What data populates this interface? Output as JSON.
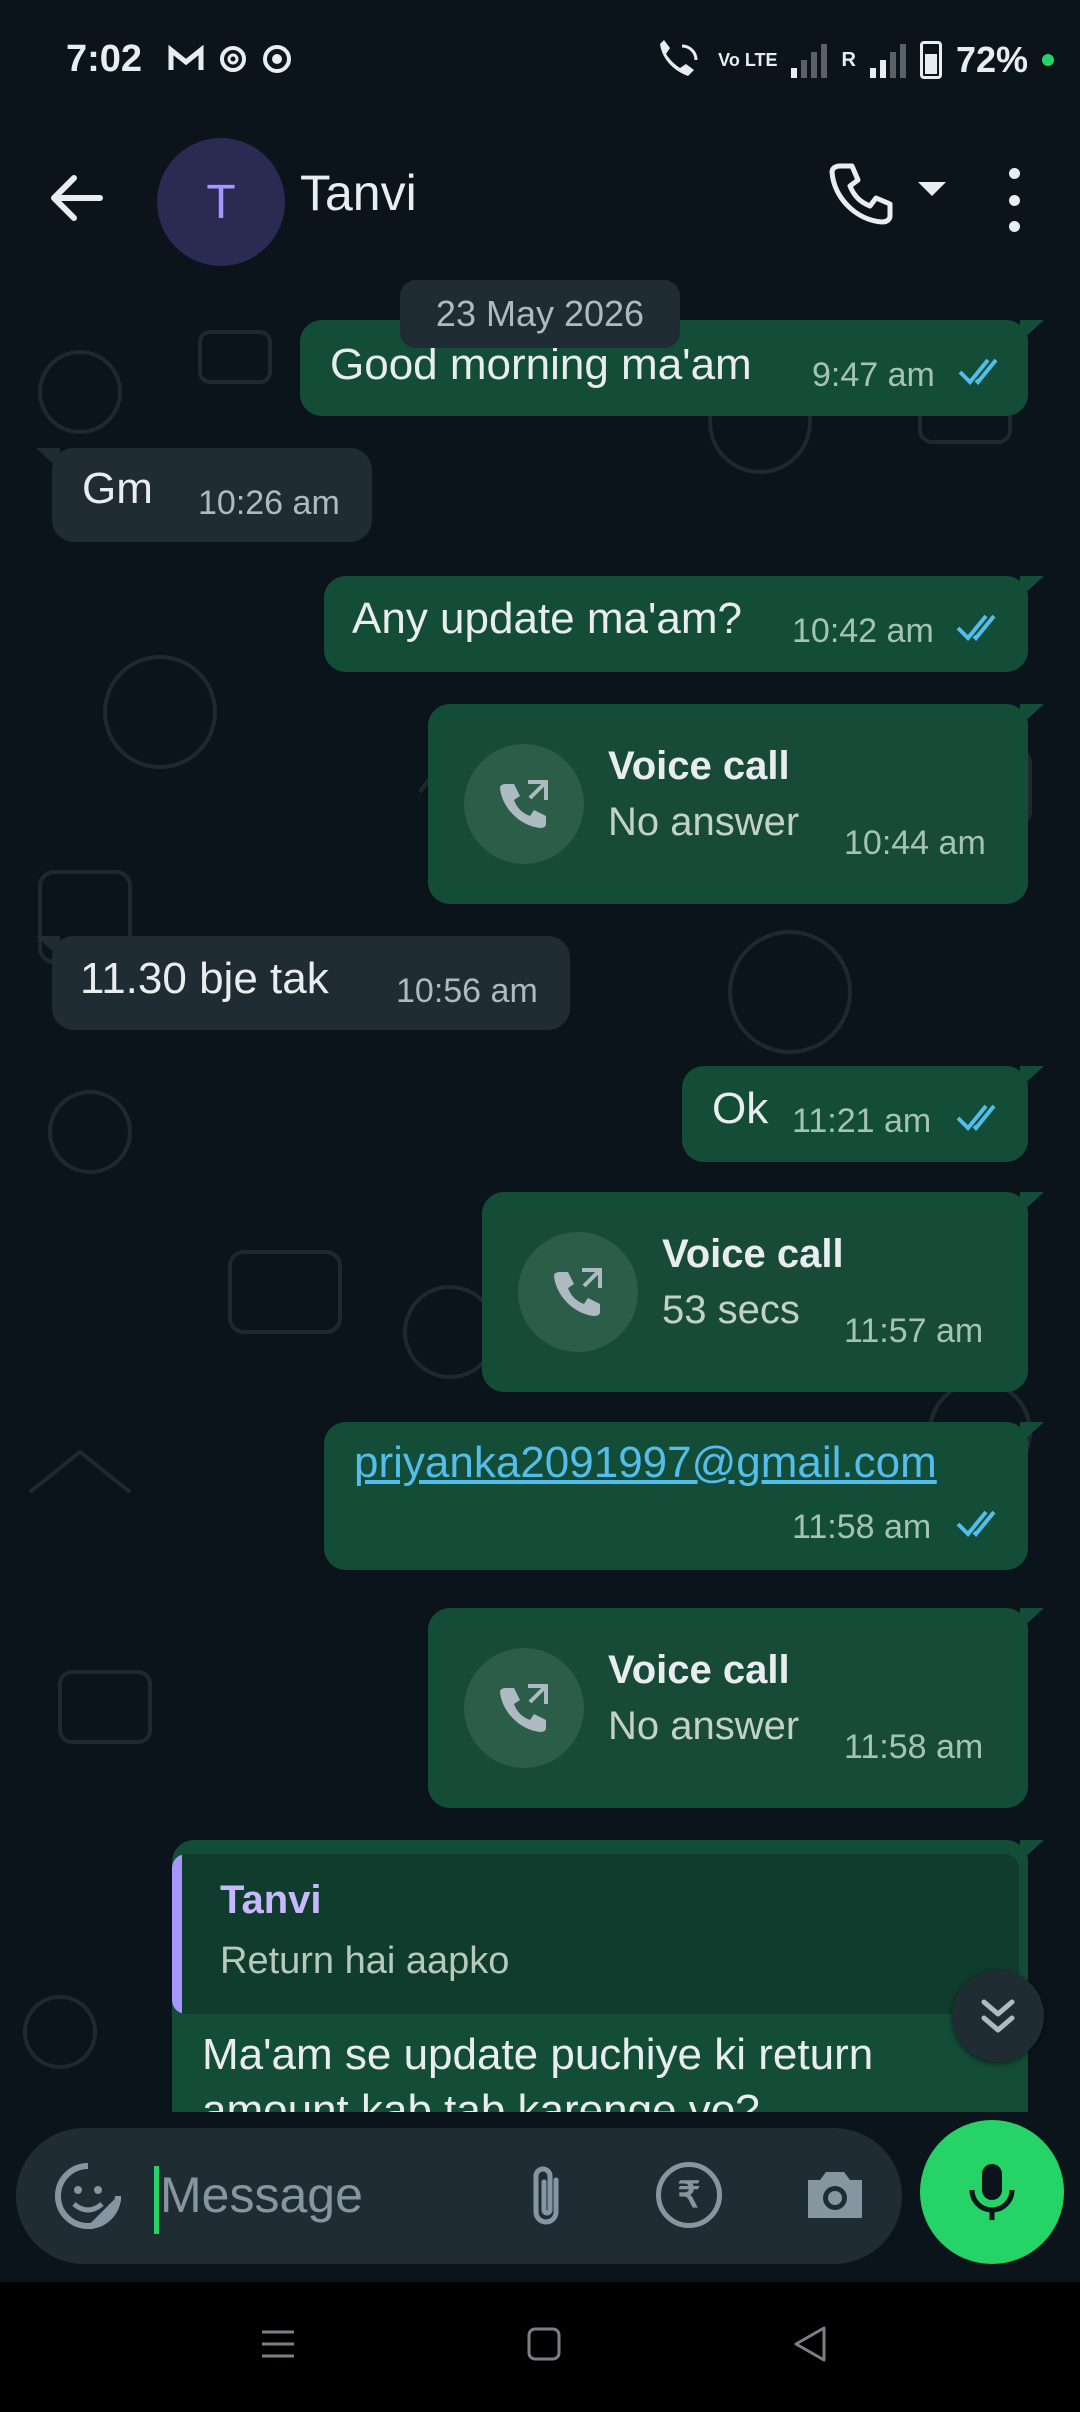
{
  "status_bar": {
    "time": "7:02",
    "network_label": "Vo LTE",
    "roaming": "R",
    "battery": "72%"
  },
  "header": {
    "avatar_initial": "T",
    "contact_name": "Tanvi"
  },
  "chat": {
    "date_chip": "23 May 2026",
    "messages": [
      {
        "text": "Good morning ma'am",
        "time": "9:47 am"
      },
      {
        "text": "Gm",
        "time": "10:26 am"
      },
      {
        "text": "Any update ma'am?",
        "time": "10:42 am"
      },
      {
        "title": "Voice call",
        "subtitle": "No answer",
        "time": "10:44 am"
      },
      {
        "text": "11.30 bje tak",
        "time": "10:56 am"
      },
      {
        "text": "Ok",
        "time": "11:21 am"
      },
      {
        "title": "Voice call",
        "subtitle": "53 secs",
        "time": "11:57 am"
      },
      {
        "text": "priyanka2091997@gmail.com",
        "time": "11:58 am"
      },
      {
        "title": "Voice call",
        "subtitle": "No answer",
        "time": "11:58 am"
      },
      {
        "quote_name": "Tanvi",
        "quote_text": "Return hai aapko",
        "text_line1": "Ma'am se update puchiye ki return",
        "text_line2": "amount kab tab karenge vo?"
      }
    ]
  },
  "composer": {
    "placeholder": "Message",
    "rupee_symbol": "₹"
  },
  "colors": {
    "outgoing_bubble": "#144d37",
    "incoming_bubble": "#1f2c34",
    "accent": "#25d366",
    "read_tick": "#53bdeb",
    "background": "#0b141a"
  }
}
